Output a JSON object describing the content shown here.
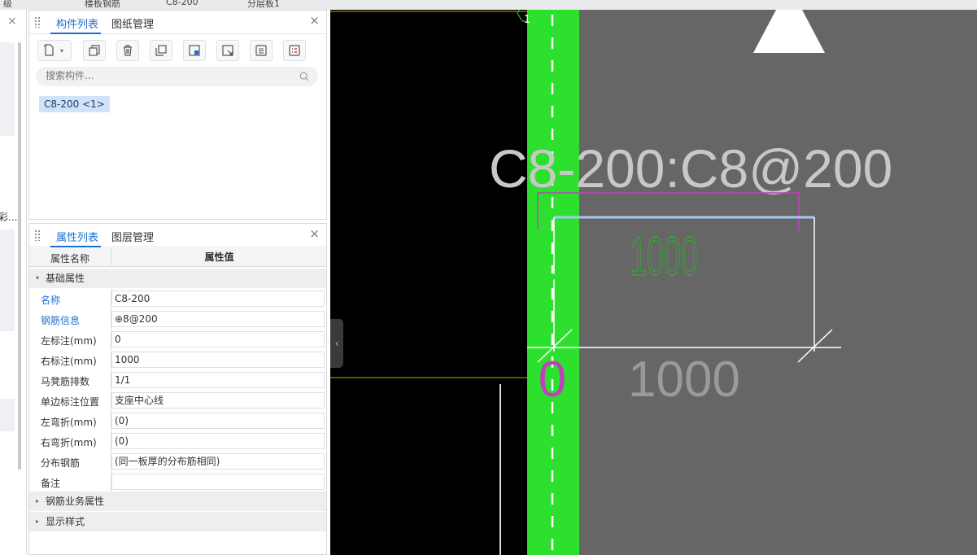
{
  "top_strip": {
    "cells": [
      "级",
      "楼板钢筋",
      "C8-200",
      "分层板1"
    ]
  },
  "left_panel": {
    "close": "×",
    "truncated_label": "彩..."
  },
  "component_panel": {
    "tabs": [
      "构件列表",
      "图纸管理"
    ],
    "active_tab": 0,
    "close": "×",
    "toolbar": [
      "new-icon",
      "dropdown-icon",
      "copy-icon",
      "delete-icon",
      "layer-copy-icon",
      "floor-copy-icon",
      "import-icon",
      "list-icon",
      "attribute-icon"
    ],
    "search": {
      "placeholder": "搜索构件..."
    },
    "items": [
      {
        "label": "C8-200 <1>"
      }
    ]
  },
  "property_panel": {
    "tabs": [
      "属性列表",
      "图层管理"
    ],
    "active_tab": 0,
    "close": "×",
    "headers": {
      "name": "属性名称",
      "value": "属性值"
    },
    "group_basic": "基础属性",
    "rows": [
      {
        "name": "名称",
        "value": "C8-200",
        "link": true
      },
      {
        "name": "钢筋信息",
        "value": "⊕8@200",
        "link": true
      },
      {
        "name": "左标注(mm)",
        "value": "0",
        "link": false
      },
      {
        "name": "右标注(mm)",
        "value": "1000",
        "link": false
      },
      {
        "name": "马凳筋排数",
        "value": "1/1",
        "link": false
      },
      {
        "name": "单边标注位置",
        "value": "支座中心线",
        "link": false
      },
      {
        "name": "左弯折(mm)",
        "value": "(0)",
        "link": false
      },
      {
        "name": "右弯折(mm)",
        "value": "(0)",
        "link": false
      },
      {
        "name": "分布钢筋",
        "value": "(同一板厚的分布筋相同)",
        "link": false
      },
      {
        "name": "备注",
        "value": "",
        "link": false
      }
    ],
    "group_rebar": "钢筋业务属性",
    "group_display": "显示样式"
  },
  "canvas": {
    "axis_label": "1",
    "rebar_label": "C8-200:C8@200",
    "green_dim": "1000",
    "zero_dim": "0",
    "bottom_dim": "1000",
    "colors": {
      "green_beam": "#2ee02e",
      "slab_gray": "#666666",
      "magenta": "#c040c0",
      "dim_green": "#22c022",
      "rebar_blue": "#a6c8f0"
    }
  }
}
